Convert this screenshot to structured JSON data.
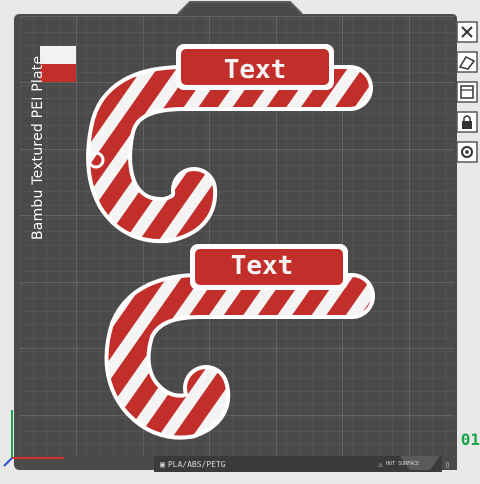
{
  "plate": {
    "label": "Bambu Textured PEI Plate",
    "filament_label": "PLA/ABS/PETG",
    "surface_label": "HOT SURFACE"
  },
  "models": [
    {
      "name": "candy-cane-1",
      "text": "Text"
    },
    {
      "name": "candy-cane-2",
      "text": "Text"
    }
  ],
  "toolbar": {
    "items": [
      {
        "name": "close-icon"
      },
      {
        "name": "auto-arrange-icon"
      },
      {
        "name": "layers-icon"
      },
      {
        "name": "lock-icon"
      },
      {
        "name": "settings-icon"
      }
    ]
  },
  "plate_number": "01",
  "colors": {
    "plate_bg": "#4a4a4a",
    "grid": "#6a6a6a",
    "cane_red": "#c22f2a",
    "cane_white": "#f4f4f4",
    "accent_green": "#17a34a"
  }
}
